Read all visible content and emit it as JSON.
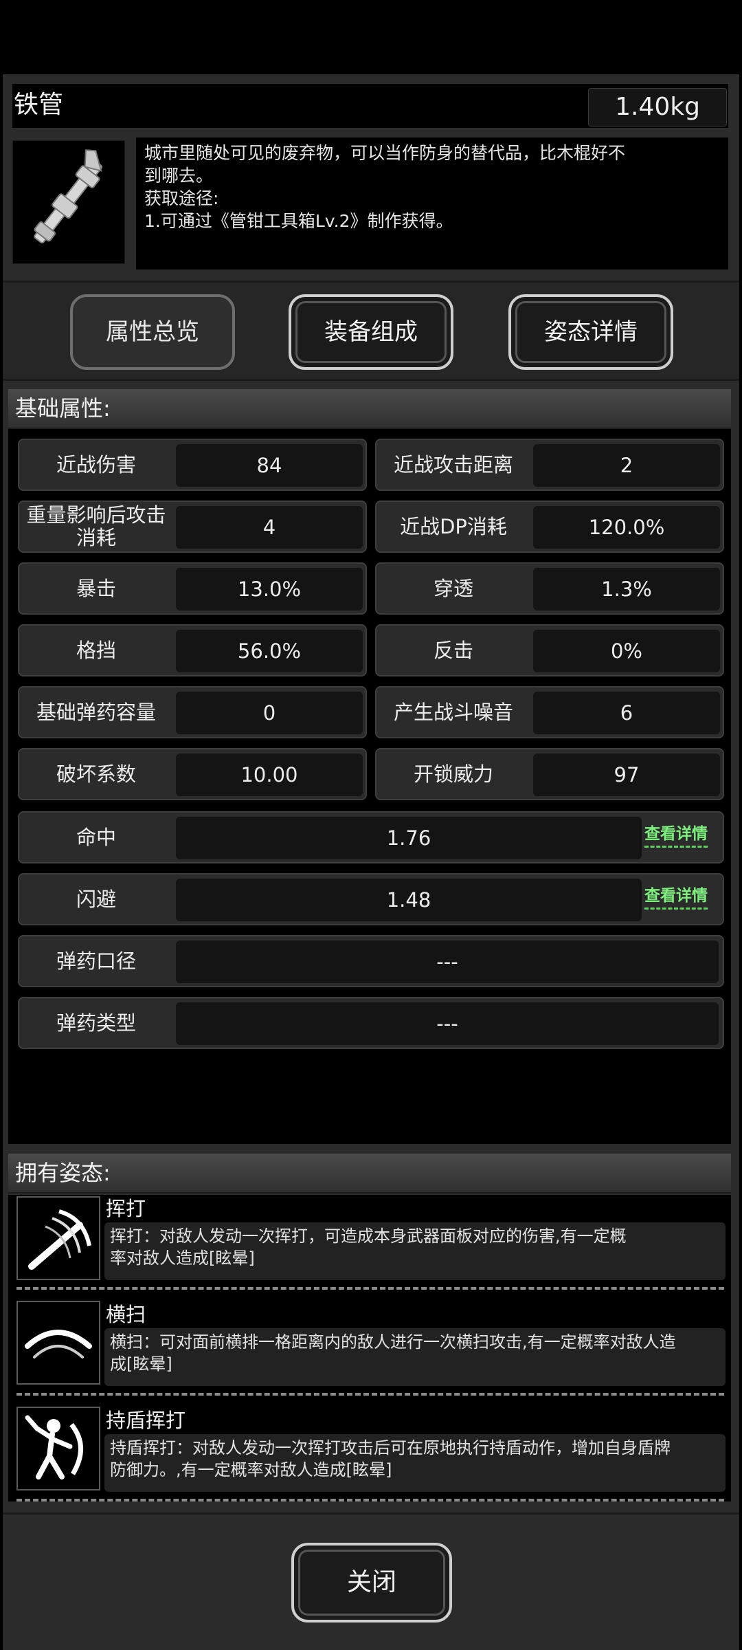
{
  "item": {
    "name": "铁管",
    "weight": "1.40kg",
    "description": [
      "城市里随处可见的废弃物，可以当作防身的替代品，比木棍好不",
      "到哪去。",
      "获取途径:",
      "1.可通过《管钳工具箱Lv.2》制作获得。"
    ]
  },
  "tabs": [
    {
      "label": "属性总览",
      "active": true
    },
    {
      "label": "装备组成",
      "active": false
    },
    {
      "label": "姿态详情",
      "active": false
    }
  ],
  "basic_section_title": "基础属性:",
  "stats_pairs": [
    [
      {
        "label": "近战伤害",
        "value": "84"
      },
      {
        "label": "近战攻击距离",
        "value": "2"
      }
    ],
    [
      {
        "label": "重量影响后攻击消耗",
        "value": "4"
      },
      {
        "label": "近战DP消耗",
        "value": "120.0%"
      }
    ],
    [
      {
        "label": "暴击",
        "value": "13.0%"
      },
      {
        "label": "穿透",
        "value": "1.3%"
      }
    ],
    [
      {
        "label": "格挡",
        "value": "56.0%"
      },
      {
        "label": "反击",
        "value": "0%"
      }
    ],
    [
      {
        "label": "基础弹药容量",
        "value": "0"
      },
      {
        "label": "产生战斗噪音",
        "value": "6"
      }
    ],
    [
      {
        "label": "破坏系数",
        "value": "10.00"
      },
      {
        "label": "开锁威力",
        "value": "97"
      }
    ]
  ],
  "stats_wide": [
    {
      "label": "命中",
      "value": "1.76",
      "link": "查看详情"
    },
    {
      "label": "闪避",
      "value": "1.48",
      "link": "查看详情"
    },
    {
      "label": "弹药口径",
      "value": "---"
    },
    {
      "label": "弹药类型",
      "value": "---"
    }
  ],
  "stance_section_title": "拥有姿态:",
  "stances": [
    {
      "name": "挥打",
      "icon": "swing-strike-icon",
      "desc": [
        "挥打：对敌人发动一次挥打，可造成本身武器面板对应的伤害,有一定概",
        "率对敌人造成[眩晕]"
      ]
    },
    {
      "name": "横扫",
      "icon": "sweep-arc-icon",
      "desc": [
        "横扫：可对面前横排一格距离内的敌人进行一次横扫攻击,有一定概率对敌人造",
        "成[眩晕]"
      ]
    },
    {
      "name": "持盾挥打",
      "icon": "shield-swing-icon",
      "desc": [
        "持盾挥打：对敌人发动一次挥打攻击后可在原地执行持盾动作，增加自身盾牌",
        "防御力。,有一定概率对敌人造成[眩晕]"
      ]
    }
  ],
  "close_label": "关闭",
  "colors": {
    "link": "#7df07d",
    "panel": "#2b2b2b"
  }
}
